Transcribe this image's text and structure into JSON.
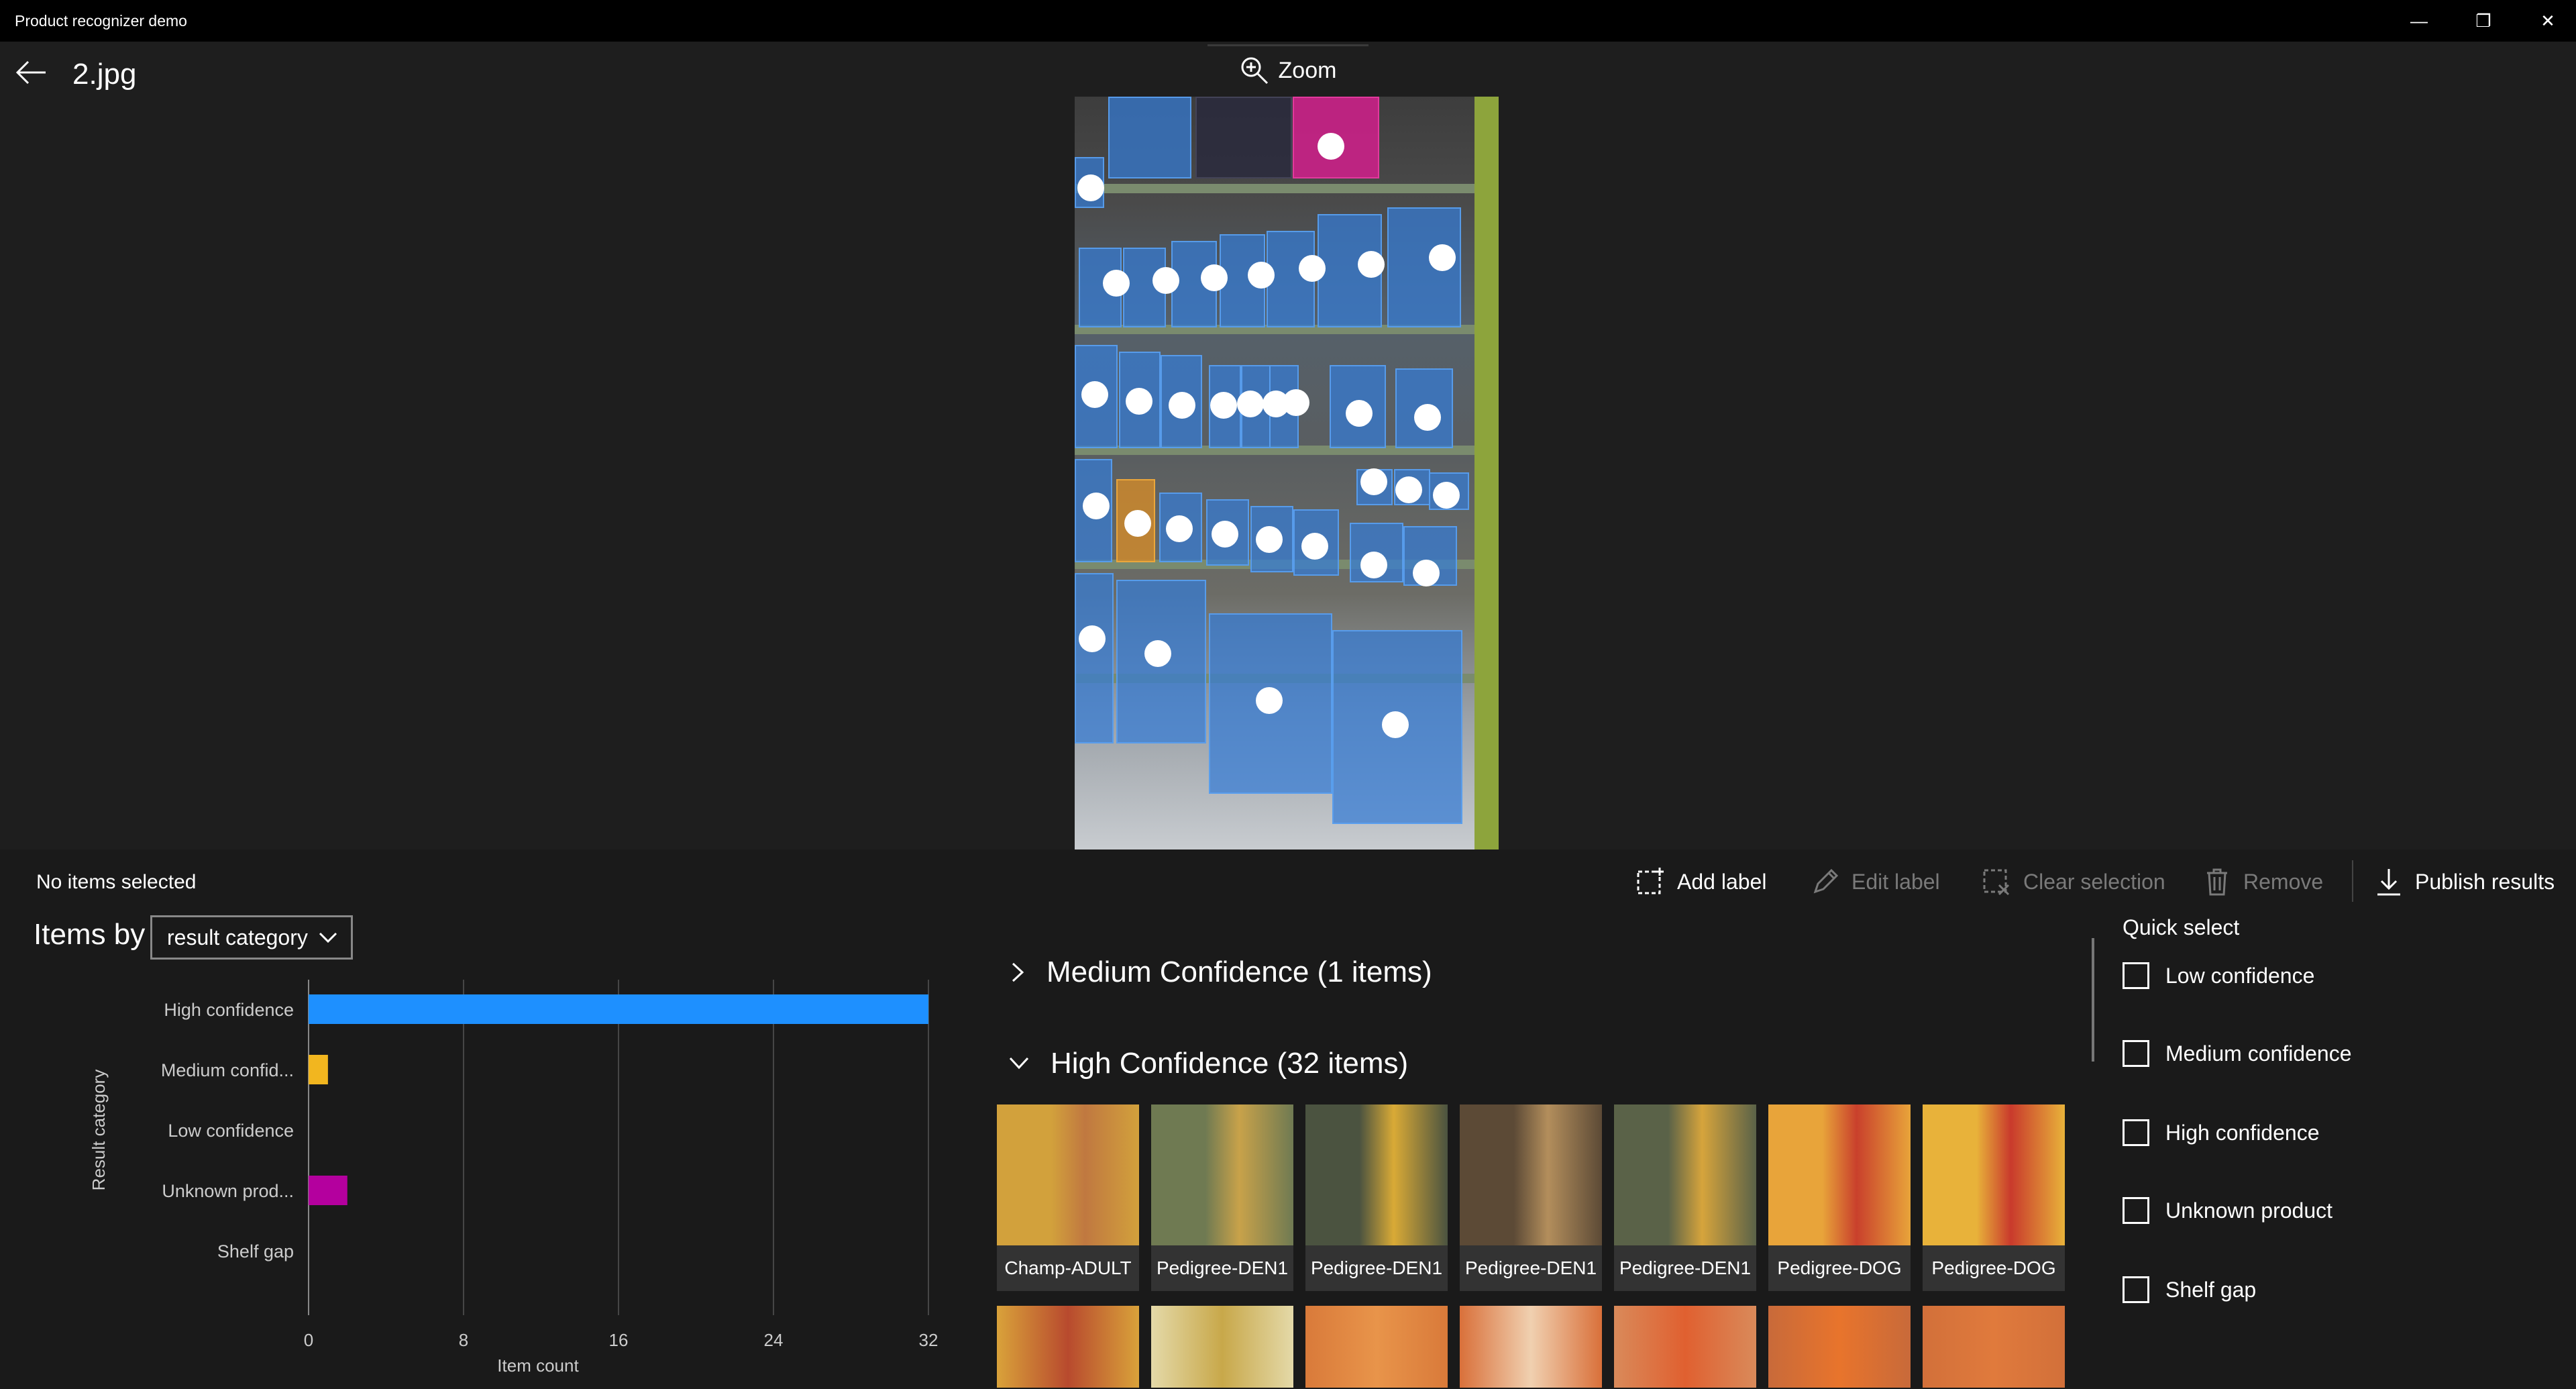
{
  "window": {
    "title": "Product recognizer demo",
    "minimize_glyph": "—",
    "restore_glyph": "❐",
    "close_glyph": "✕"
  },
  "header": {
    "file_name": "2.jpg",
    "zoom_label": "Zoom"
  },
  "toolbar": {
    "selection_status": "No items selected",
    "add_label": "Add label",
    "edit_label": "Edit label",
    "clear_selection": "Clear selection",
    "remove": "Remove",
    "publish_results": "Publish results"
  },
  "items_by": {
    "label": "Items by",
    "selected": "result category"
  },
  "chart_data": {
    "type": "bar",
    "orientation": "horizontal",
    "categories": [
      "High confidence",
      "Medium confid...",
      "Low confidence",
      "Unknown prod...",
      "Shelf gap"
    ],
    "values": [
      32,
      1,
      0,
      2,
      0
    ],
    "colors": [
      "#1e90ff",
      "#f2b61f",
      "#7a7a7a",
      "#b4009e",
      "#7a7a7a"
    ],
    "xlabel": "Item count",
    "ylabel": "Result category",
    "xlim": [
      0,
      32
    ],
    "xticks": [
      "0",
      "8",
      "16",
      "24",
      "32"
    ],
    "grid": true
  },
  "groups": {
    "medium": {
      "title": "Medium Confidence (1 items)",
      "expanded": false
    },
    "high": {
      "title": "High Confidence (32 items)",
      "expanded": true
    }
  },
  "thumbnails": [
    {
      "label": "Champ-ADULT",
      "colors": [
        "#d2a13c",
        "#c07840"
      ]
    },
    {
      "label": "Pedigree-DEN1",
      "colors": [
        "#6f7a52",
        "#c8a24a"
      ]
    },
    {
      "label": "Pedigree-DEN1",
      "colors": [
        "#4b5340",
        "#d9aa36"
      ]
    },
    {
      "label": "Pedigree-DEN1",
      "colors": [
        "#5c4a36",
        "#b38e5c"
      ]
    },
    {
      "label": "Pedigree-DEN1",
      "colors": [
        "#5a6248",
        "#d6a43c"
      ]
    },
    {
      "label": "Pedigree-DOG",
      "colors": [
        "#e8a43a",
        "#c9402c"
      ]
    },
    {
      "label": "Pedigree-DOG",
      "colors": [
        "#e8b23a",
        "#c93a2c"
      ]
    }
  ],
  "thumbnails_row2": [
    {
      "colors": [
        "#d9a23a",
        "#b84a2e"
      ]
    },
    {
      "colors": [
        "#e4d9a8",
        "#c8a84a"
      ]
    },
    {
      "colors": [
        "#d97a3a",
        "#e8944a"
      ]
    },
    {
      "colors": [
        "#d9703a",
        "#f0d0b0"
      ]
    },
    {
      "colors": [
        "#d98a5a",
        "#e06030"
      ]
    },
    {
      "colors": [
        "#c86a3a",
        "#e8742c"
      ]
    },
    {
      "colors": [
        "#d2703a",
        "#e07a3c"
      ]
    }
  ],
  "quick_select": {
    "title": "Quick select",
    "items": [
      {
        "label": "Low confidence",
        "checked": false
      },
      {
        "label": "Medium confidence",
        "checked": false
      },
      {
        "label": "High confidence",
        "checked": false
      },
      {
        "label": "Unknown product",
        "checked": false
      },
      {
        "label": "Shelf gap",
        "checked": false
      }
    ]
  }
}
